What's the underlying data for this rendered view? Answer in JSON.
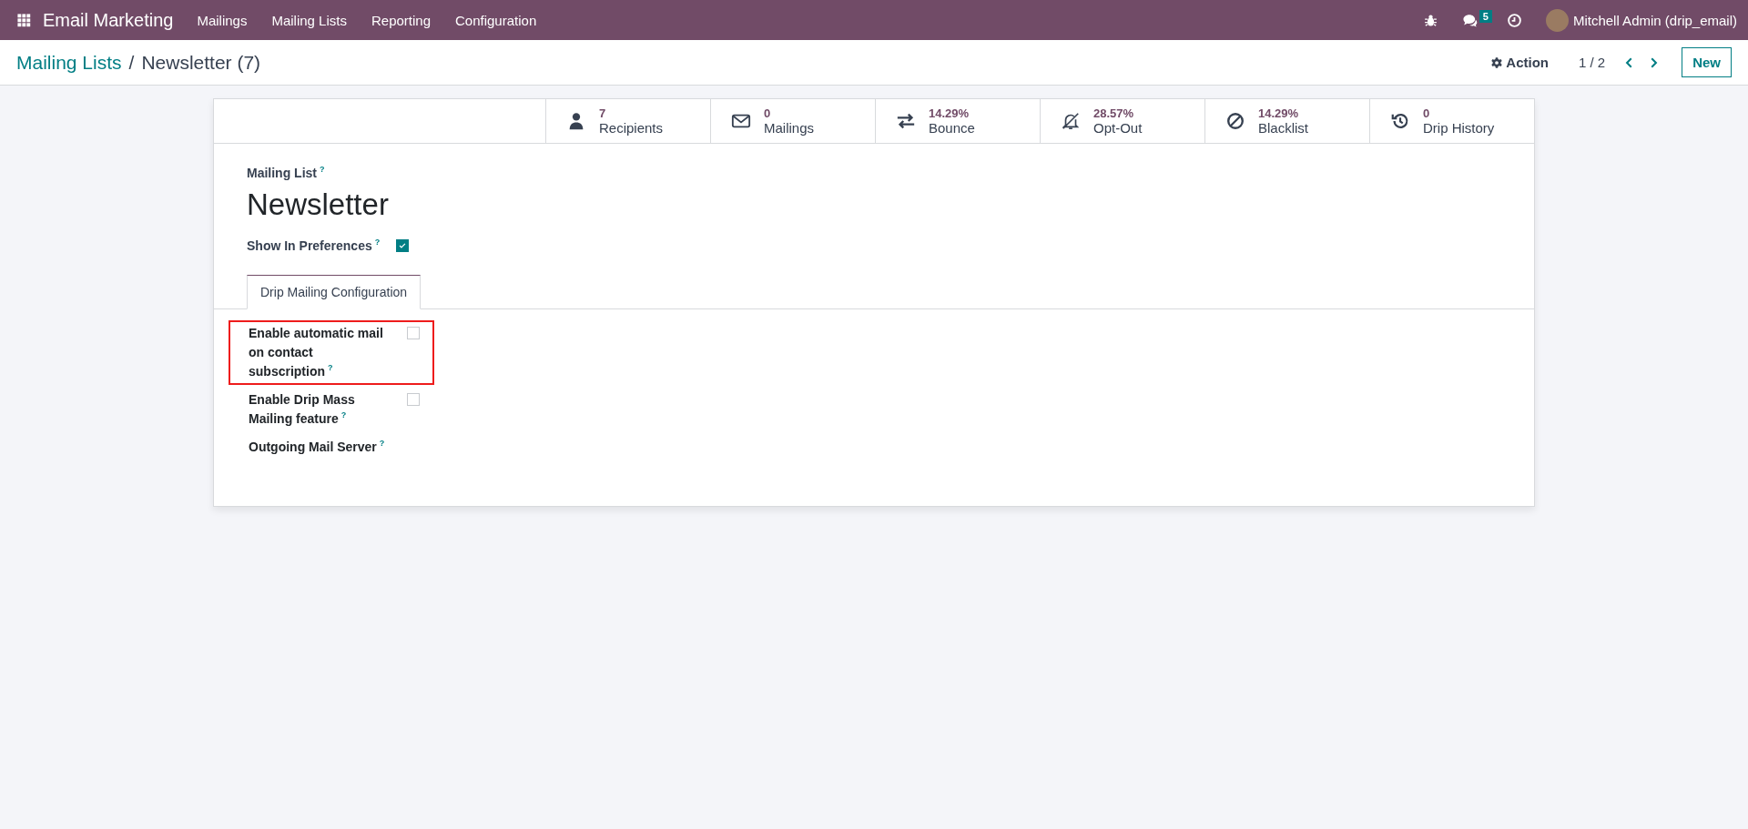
{
  "navbar": {
    "app_name": "Email Marketing",
    "menu": [
      {
        "label": "Mailings"
      },
      {
        "label": "Mailing Lists"
      },
      {
        "label": "Reporting"
      },
      {
        "label": "Configuration"
      }
    ],
    "messages_count": "5",
    "user": "Mitchell Admin (drip_email)"
  },
  "control_panel": {
    "breadcrumb": [
      {
        "label": "Mailing Lists",
        "kind": "link"
      },
      {
        "label": "/",
        "kind": "separator"
      },
      {
        "label": "Newsletter (7)",
        "kind": "current"
      }
    ],
    "action": "Action",
    "pager": "1 / 2",
    "new_button": "New"
  },
  "stat_buttons": [
    {
      "kind": "recipients",
      "value": "7",
      "label": "Recipients"
    },
    {
      "kind": "mailings",
      "value": "0",
      "label": "Mailings"
    },
    {
      "kind": "bounce",
      "value": "14.29%",
      "label": "Bounce"
    },
    {
      "kind": "optout",
      "value": "28.57%",
      "label": "Opt-Out"
    },
    {
      "kind": "blacklist",
      "value": "14.29%",
      "label": "Blacklist"
    },
    {
      "kind": "history",
      "value": "0",
      "label": "Drip History"
    }
  ],
  "form": {
    "title_label": "Mailing List$^{?}$",
    "name": "Newsletter",
    "show_in_preferences": {
      "label": "Show In Preferences$^{?}$",
      "checked": true
    },
    "tabs": [
      {
        "label": "Drip Mailing Configuration",
        "selected": true
      }
    ],
    "fields": [
      {
        "kind": "checkbox",
        "label": "Enable automatic mail on contact subscription$^{?}$",
        "checked": false,
        "highlighted": true
      },
      {
        "kind": "checkbox",
        "label": "Enable Drip Mass Mailing feature$^{?}$",
        "checked": false,
        "highlighted": false
      },
      {
        "kind": "label",
        "label": "Outgoing Mail Server$^{?}$"
      }
    ]
  }
}
